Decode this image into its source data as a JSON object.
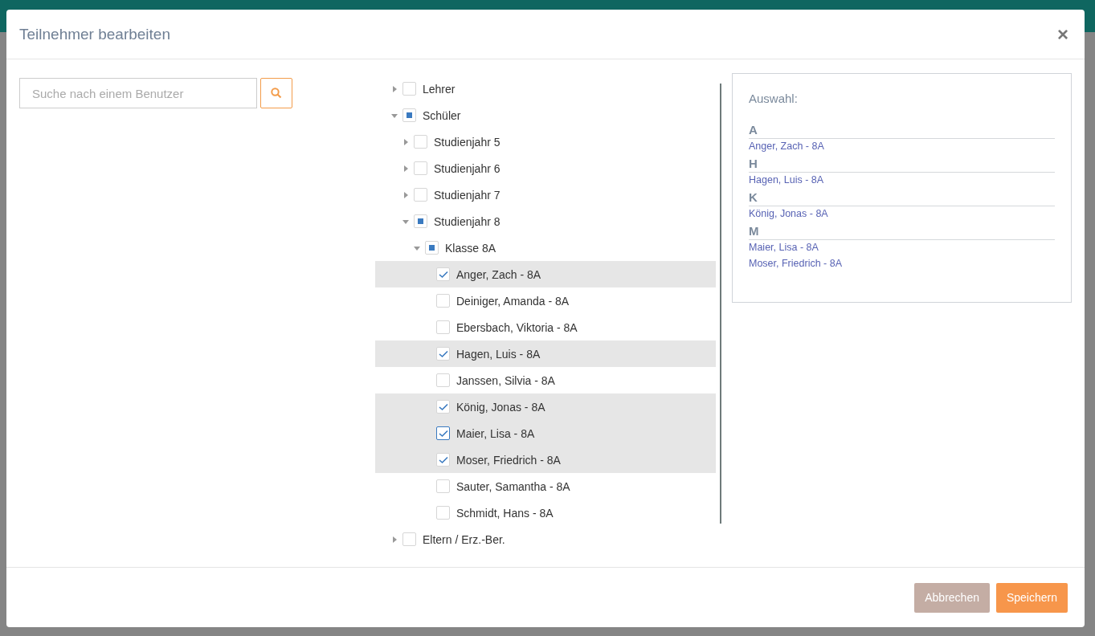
{
  "dialog": {
    "title": "Teilnehmer bearbeiten",
    "close": "×"
  },
  "search": {
    "placeholder": "Suche nach einem Benutzer"
  },
  "tree": [
    {
      "label": "Lehrer",
      "expanded": false,
      "partial": false
    },
    {
      "label": "Schüler",
      "expanded": true,
      "partial": true,
      "children": [
        {
          "label": "Studienjahr 5",
          "expanded": false,
          "partial": false
        },
        {
          "label": "Studienjahr 6",
          "expanded": false,
          "partial": false
        },
        {
          "label": "Studienjahr 7",
          "expanded": false,
          "partial": false
        },
        {
          "label": "Studienjahr 8",
          "expanded": true,
          "partial": true,
          "children": [
            {
              "label": "Klasse 8A",
              "expanded": true,
              "partial": true,
              "children": [
                {
                  "label": "Anger, Zach - 8A",
                  "kind": "leaf",
                  "checked": true,
                  "selected": true
                },
                {
                  "label": "Deiniger, Amanda - 8A",
                  "kind": "leaf",
                  "checked": false,
                  "selected": false
                },
                {
                  "label": "Ebersbach, Viktoria - 8A",
                  "kind": "leaf",
                  "checked": false,
                  "selected": false
                },
                {
                  "label": "Hagen, Luis - 8A",
                  "kind": "leaf",
                  "checked": true,
                  "selected": true
                },
                {
                  "label": "Janssen, Silvia - 8A",
                  "kind": "leaf",
                  "checked": false,
                  "selected": false
                },
                {
                  "label": "König, Jonas - 8A",
                  "kind": "leaf",
                  "checked": true,
                  "selected": true
                },
                {
                  "label": "Maier, Lisa - 8A",
                  "kind": "leaf",
                  "checked": true,
                  "selected": true,
                  "focused": true
                },
                {
                  "label": "Moser, Friedrich - 8A",
                  "kind": "leaf",
                  "checked": true,
                  "selected": true
                },
                {
                  "label": "Sauter, Samantha - 8A",
                  "kind": "leaf",
                  "checked": false,
                  "selected": false
                },
                {
                  "label": "Schmidt, Hans - 8A",
                  "kind": "leaf",
                  "checked": false,
                  "selected": false
                }
              ]
            }
          ]
        }
      ]
    },
    {
      "label": "Eltern / Erz.-Ber.",
      "expanded": false,
      "partial": false
    }
  ],
  "selection": {
    "title": "Auswahl:",
    "groups": [
      {
        "letter": "A",
        "names": [
          "Anger, Zach - 8A"
        ]
      },
      {
        "letter": "H",
        "names": [
          "Hagen, Luis - 8A"
        ]
      },
      {
        "letter": "K",
        "names": [
          "König, Jonas - 8A"
        ]
      },
      {
        "letter": "M",
        "names": [
          "Maier, Lisa - 8A",
          "Moser, Friedrich - 8A"
        ]
      }
    ]
  },
  "buttons": [
    {
      "label": "Abbrechen",
      "kind": "cancel"
    },
    {
      "label": "Speichern",
      "kind": "primary"
    }
  ]
}
